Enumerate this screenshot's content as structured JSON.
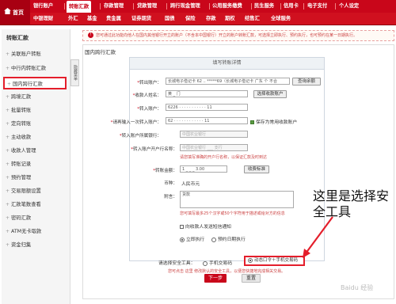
{
  "nav": {
    "home": "首页",
    "row1": [
      "银行账户",
      "转账汇款",
      "存款管理",
      "贷款管理",
      "跨行现金管理",
      "公用服务缴费",
      "民生服务",
      "信用卡",
      "电子支付",
      "个人设定"
    ],
    "row2": [
      "中银理财",
      "外汇",
      "基金",
      "贵金属",
      "证券期货",
      "国债",
      "保险",
      "存款",
      "期权",
      "结售汇",
      "全球服务"
    ],
    "active_index": 1
  },
  "sidebar": {
    "title": "转账汇款",
    "items": [
      "关联账户转账",
      "中行内转账汇款",
      "国内跨行汇款",
      "跨境汇款",
      "批量转账",
      "定向转账",
      "主动收款",
      "收款人管理",
      "转账记录",
      "预约管理",
      "交易限额设置",
      "汇款笔数查看",
      "密码汇款",
      "ATM无卡取款",
      "资金归集"
    ],
    "active_index": 2,
    "collapse_label": "隐藏菜单"
  },
  "notice": "您可通过此功能向他人在国内其他银行开立的账户（不含本中国银行）开立的账户转账汇款，可选择立即执行、预约执行，也可预约在某一日期执行。",
  "page": {
    "title": "国内跨行汇款",
    "form_title": "填写转账详情"
  },
  "form": {
    "from_account_label": "转出账户：",
    "from_account_value": "长城电子借记卡 62 .. *****69（长城电子借记卡 广东 个 不合",
    "query_balance_btn": "查询余额",
    "payee_name_label": "收款人姓名：",
    "payee_name_value": "黄 _ 门",
    "select_payee_btn": "选择收款账户",
    "to_account_label": "转入账户：",
    "to_account_value": "6226 · · · · · · · · · · · 11",
    "confirm_account_label": "请再输入一次转入账户：",
    "confirm_account_value": "62 · · · · · · · · · · · · 11",
    "save_payee_label": "保存为常用收款账户",
    "bank_label": "转入账户所属银行：",
    "bank_value": "中国农业银行",
    "branch_label": "转入账户开户行名称：",
    "branch_value": "中国农业银行 ___ 支行",
    "branch_hint": "请您填写准确的开户行名称，以保证汇款及时到达",
    "amount_label": "转账金额：",
    "amount_value": "1 _ _ _ 3.00",
    "fee_btn": "收费标准",
    "currency_label": "币种：",
    "currency_value": "人民币元",
    "memo_label": "附言：",
    "memo_value": "货款",
    "memo_hint": "您可填写最多25个汉字或50个字符用于描述或给对方的信息",
    "sms_label": "向收款人发送短信通知",
    "exec_now": "立即执行",
    "exec_schedule": "预约日期执行"
  },
  "security": {
    "label": "请选择安全工具：",
    "option1": "手机交易码",
    "option2": "动态口令＋手机交易码",
    "note": "您可点击 这里 修改默认的安全工具，以便您快捷地完成相关交易。"
  },
  "buttons": {
    "next": "下一步",
    "reset": "重置"
  },
  "annotation": "这里是选择安全工具",
  "watermark": "Baidu 经验",
  "colors": {
    "brand": "#c9061a",
    "highlight": "#e41e2b"
  }
}
